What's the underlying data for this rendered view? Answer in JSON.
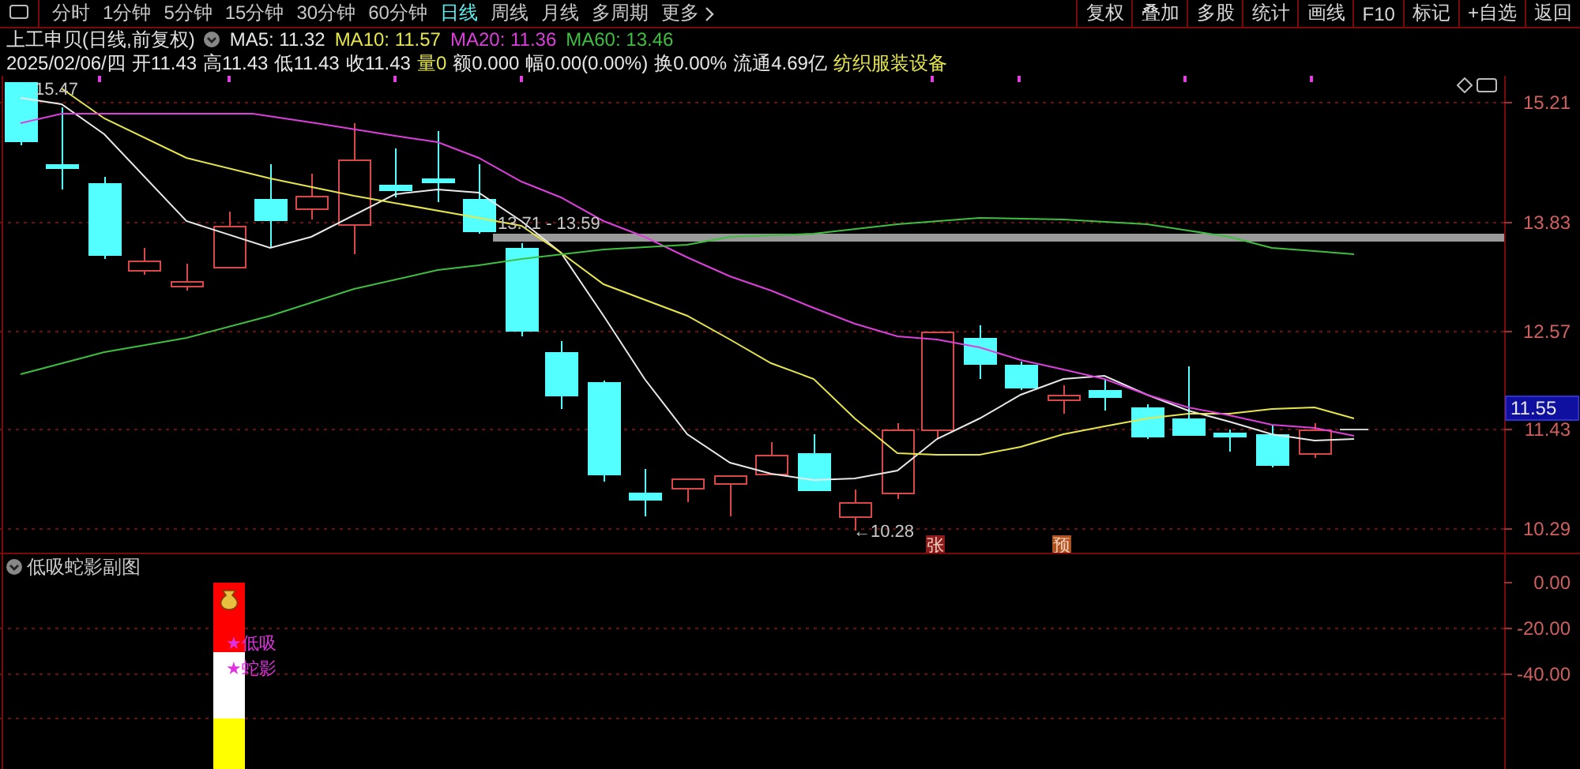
{
  "toolbar": {
    "periods": [
      {
        "label": "分时",
        "selected": false
      },
      {
        "label": "1分钟",
        "selected": false
      },
      {
        "label": "5分钟",
        "selected": false
      },
      {
        "label": "15分钟",
        "selected": false
      },
      {
        "label": "30分钟",
        "selected": false
      },
      {
        "label": "60分钟",
        "selected": false
      },
      {
        "label": "日线",
        "selected": true
      },
      {
        "label": "周线",
        "selected": false
      },
      {
        "label": "月线",
        "selected": false
      },
      {
        "label": "多周期",
        "selected": false
      },
      {
        "label": "更多",
        "selected": false
      }
    ],
    "buttons": [
      "复权",
      "叠加",
      "多股",
      "统计",
      "画线",
      "F10",
      "标记",
      "+自选",
      "返回"
    ]
  },
  "quote": {
    "title": "上工申贝(日线,前复权)",
    "averages": [
      {
        "label": "MA5: 11.32",
        "color": "#e8e8e8"
      },
      {
        "label": "MA10: 11.57",
        "color": "#e6e64c"
      },
      {
        "label": "MA20: 11.36",
        "color": "#dd3fdd"
      },
      {
        "label": "MA60: 13.46",
        "color": "#3fbf3f"
      }
    ],
    "details": [
      {
        "text": "2025/02/06/四",
        "color": "#e8e8e8"
      },
      {
        "text": "开11.43",
        "color": "#e8e8e8"
      },
      {
        "text": "高11.43",
        "color": "#e8e8e8"
      },
      {
        "text": "低11.43",
        "color": "#e8e8e8"
      },
      {
        "text": "收11.43",
        "color": "#e8e8e8"
      },
      {
        "text": "量0",
        "color": "#e6e64c"
      },
      {
        "text": "额0.000",
        "color": "#e8e8e8"
      },
      {
        "text": "幅0.00(0.00%)",
        "color": "#e8e8e8"
      },
      {
        "text": "换0.00%",
        "color": "#e8e8e8"
      },
      {
        "text": "流通4.69亿",
        "color": "#e8e8e8"
      },
      {
        "text": "纺织服装设备",
        "color": "#e6e64c"
      }
    ]
  },
  "price_chart": {
    "axis_labels": [
      "15.21",
      "13.83",
      "12.57",
      "11.43",
      "10.29"
    ],
    "current_price": "11.55",
    "annotations": [
      "15.47",
      "13.71 - 13.59",
      "←10.28"
    ],
    "markers": [
      {
        "text": "张",
        "color": "#8c1c1c"
      },
      {
        "text": "预",
        "color": "#b0501a"
      }
    ]
  },
  "indicator_panel": {
    "title": "低吸蛇影副图",
    "signals": [
      "★低吸",
      "★蛇影"
    ],
    "axis_labels": [
      "0.00",
      "-20.00",
      "-40.00"
    ]
  }
}
